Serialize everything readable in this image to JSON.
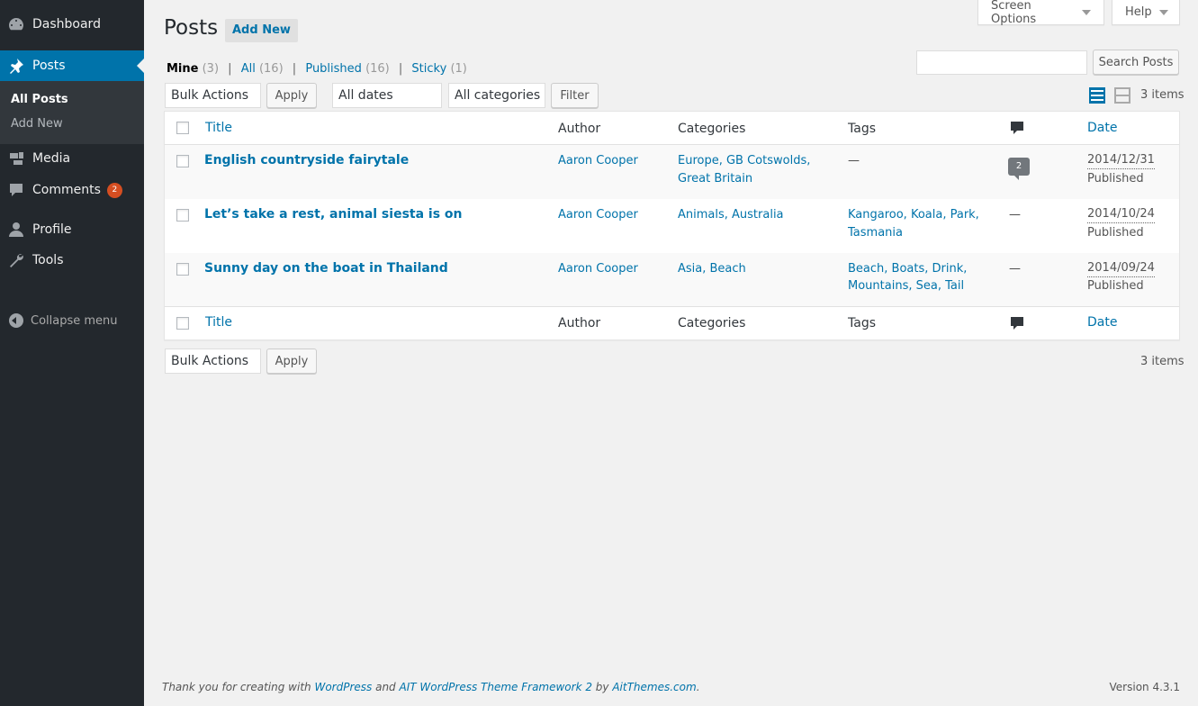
{
  "sidebar": {
    "dashboard": "Dashboard",
    "posts": "Posts",
    "all_posts": "All Posts",
    "add_new": "Add New",
    "media": "Media",
    "comments": "Comments",
    "comments_badge": "2",
    "profile": "Profile",
    "tools": "Tools",
    "collapse": "Collapse menu"
  },
  "top_tabs": {
    "screen_options": "Screen Options",
    "help": "Help"
  },
  "header": {
    "title": "Posts",
    "add_new": "Add New"
  },
  "filters": {
    "mine": "Mine",
    "mine_count": "(3)",
    "all": "All",
    "all_count": "(16)",
    "published": "Published",
    "published_count": "(16)",
    "sticky": "Sticky",
    "sticky_count": "(1)",
    "sep": "|"
  },
  "search": {
    "value": "",
    "button": "Search Posts"
  },
  "toolbar": {
    "bulk_actions": "Bulk Actions",
    "apply": "Apply",
    "all_dates": "All dates",
    "all_categories": "All categories",
    "filter": "Filter",
    "items": "3 items"
  },
  "table": {
    "columns": {
      "title": "Title",
      "author": "Author",
      "categories": "Categories",
      "tags": "Tags",
      "date": "Date"
    },
    "rows": [
      {
        "title": "English countryside fairytale",
        "author": "Aaron Cooper",
        "categories_line1": "Europe, GB Cotswolds,",
        "categories_line2": "Great Britain",
        "tags_line1": "—",
        "tags_line2": "",
        "comments": "2",
        "date": "2014/12/31",
        "status": "Published"
      },
      {
        "title": "Let’s take a rest, animal siesta is on",
        "author": "Aaron Cooper",
        "categories_line1": "Animals, Australia",
        "categories_line2": "",
        "tags_line1": "Kangaroo, Koala, Park,",
        "tags_line2": "Tasmania",
        "comments": "—",
        "date": "2014/10/24",
        "status": "Published"
      },
      {
        "title": "Sunny day on the boat in Thailand",
        "author": "Aaron Cooper",
        "categories_line1": "Asia, Beach",
        "categories_line2": "",
        "tags_line1": "Beach, Boats, Drink,",
        "tags_line2": "Mountains, Sea, Tail",
        "comments": "—",
        "date": "2014/09/24",
        "status": "Published"
      }
    ]
  },
  "footer": {
    "thanks_prefix": "Thank you for creating with ",
    "wordpress": "WordPress",
    "and": " and ",
    "ait": "AIT WordPress Theme Framework 2",
    "by": " by ",
    "aitthemes": "AitThemes.com",
    "period": ".",
    "version": "Version 4.3.1"
  },
  "colors": {
    "sidebar_bg": "#23282d",
    "accent": "#0073aa",
    "badge": "#d54e21"
  }
}
